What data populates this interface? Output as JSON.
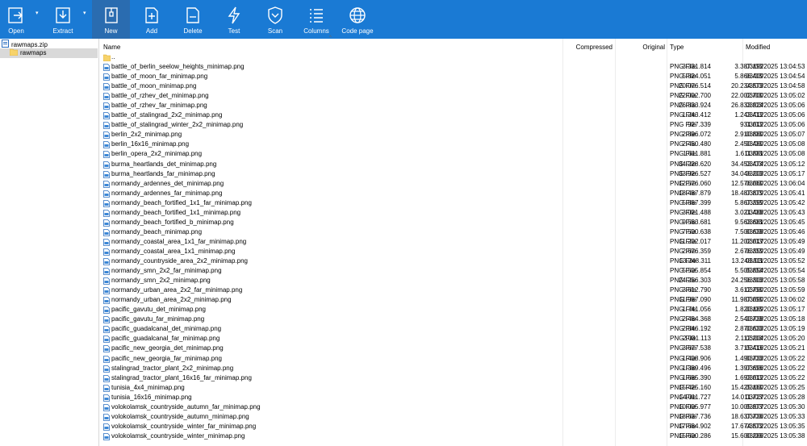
{
  "toolbar": [
    {
      "label": "Open",
      "icon": "open-icon",
      "name": "open",
      "dropdown": true
    },
    {
      "label": "Extract",
      "icon": "extract-icon",
      "name": "extract",
      "dropdown": true
    },
    {
      "label": "New",
      "icon": "new-archive-icon",
      "name": "new",
      "active": true
    },
    {
      "label": "Add",
      "icon": "add-icon",
      "name": "add"
    },
    {
      "label": "Delete",
      "icon": "delete-icon",
      "name": "delete"
    },
    {
      "label": "Test",
      "icon": "test-icon",
      "name": "test"
    },
    {
      "label": "Scan",
      "icon": "scan-icon",
      "name": "scan"
    },
    {
      "label": "Columns",
      "icon": "columns-icon",
      "name": "columns"
    },
    {
      "label": "Code page",
      "icon": "code-page-icon",
      "name": "code-page"
    }
  ],
  "tree": {
    "archive": "rawmaps.zip",
    "folder": "rawmaps"
  },
  "columns": {
    "name": "Name",
    "compressed": "Compressed",
    "original": "Original",
    "type": "Type",
    "modified": "Modified"
  },
  "parent_row": "..",
  "files": [
    {
      "name": "battle_of_berlin_seelow_heights_minimap.png",
      "compressed": "3.331.814",
      "original": "3.387.192",
      "type": "PNG File",
      "modified": "03/03/2025 13:04:53"
    },
    {
      "name": "battle_of_moon_far_minimap.png",
      "compressed": "5.824.051",
      "original": "5.866.409",
      "type": "PNG File",
      "modified": "03/03/2025 13:04:54"
    },
    {
      "name": "battle_of_moon_minimap.png",
      "compressed": "20.076.514",
      "original": "20.234.573",
      "type": "PNG File",
      "modified": "03/03/2025 13:04:58"
    },
    {
      "name": "battle_of_rzhev_det_minimap.png",
      "compressed": "22.002.700",
      "original": "22.002.700",
      "type": "PNG File",
      "modified": "03/03/2025 13:05:02"
    },
    {
      "name": "battle_of_rzhev_far_minimap.png",
      "compressed": "26.833.924",
      "original": "26.833.924",
      "type": "PNG File",
      "modified": "03/03/2025 13:05:06"
    },
    {
      "name": "battle_of_stalingrad_2x2_minimap.png",
      "compressed": "1.243.412",
      "original": "1.243.412",
      "type": "PNG File",
      "modified": "03/03/2025 13:05:06"
    },
    {
      "name": "battle_of_stalingrad_winter_2x2_minimap.png",
      "compressed": "927.339",
      "original": "931.012",
      "type": "PNG File",
      "modified": "03/03/2025 13:05:06"
    },
    {
      "name": "berlin_2x2_minimap.png",
      "compressed": "2.896.072",
      "original": "2.910.880",
      "type": "PNG File",
      "modified": "03/03/2025 13:05:07"
    },
    {
      "name": "berlin_16x16_minimap.png",
      "compressed": "2.450.480",
      "original": "2.450.480",
      "type": "PNG File",
      "modified": "03/03/2025 13:05:08"
    },
    {
      "name": "berlin_opera_2x2_minimap.png",
      "compressed": "1.611.881",
      "original": "1.611.881",
      "type": "PNG File",
      "modified": "03/03/2025 13:05:08"
    },
    {
      "name": "burma_heartlands_det_minimap.png",
      "compressed": "34.228.620",
      "original": "34.453.474",
      "type": "PNG File",
      "modified": "03/03/2025 13:05:12"
    },
    {
      "name": "burma_heartlands_far_minimap.png",
      "compressed": "33.926.527",
      "original": "34.046.203",
      "type": "PNG File",
      "modified": "03/03/2025 13:05:17"
    },
    {
      "name": "normandy_ardennes_det_minimap.png",
      "compressed": "12.576.060",
      "original": "12.576.060",
      "type": "PNG File",
      "modified": "03/03/2025 13:06:04"
    },
    {
      "name": "normandy_ardennes_far_minimap.png",
      "compressed": "18.487.879",
      "original": "18.487.879",
      "type": "PNG File",
      "modified": "03/03/2025 13:05:41"
    },
    {
      "name": "normandy_beach_fortified_1x1_far_minimap.png",
      "compressed": "5.867.399",
      "original": "5.867.399",
      "type": "PNG File",
      "modified": "03/03/2025 13:05:42"
    },
    {
      "name": "normandy_beach_fortified_1x1_minimap.png",
      "compressed": "3.021.488",
      "original": "3.021.488",
      "type": "PNG File",
      "modified": "03/03/2025 13:05:43"
    },
    {
      "name": "normandy_beach_fortified_b_minimap.png",
      "compressed": "9.563.681",
      "original": "9.563.681",
      "type": "PNG File",
      "modified": "03/03/2025 13:05:45"
    },
    {
      "name": "normandy_beach_minimap.png",
      "compressed": "7.500.638",
      "original": "7.500.638",
      "type": "PNG File",
      "modified": "03/03/2025 13:05:46"
    },
    {
      "name": "normandy_coastal_area_1x1_far_minimap.png",
      "compressed": "11.202.017",
      "original": "11.202.017",
      "type": "PNG File",
      "modified": "03/03/2025 13:05:49"
    },
    {
      "name": "normandy_coastal_area_1x1_minimap.png",
      "compressed": "2.676.359",
      "original": "2.676.359",
      "type": "PNG File",
      "modified": "03/03/2025 13:05:49"
    },
    {
      "name": "normandy_countryside_area_2x2_minimap.png",
      "compressed": "13.248.311",
      "original": "13.248.311",
      "type": "PNG File",
      "modified": "03/03/2025 13:05:52"
    },
    {
      "name": "normandy_smn_2x2_far_minimap.png",
      "compressed": "5.505.854",
      "original": "5.505.854",
      "type": "PNG File",
      "modified": "03/03/2025 13:05:54"
    },
    {
      "name": "normandy_smn_2x2_minimap.png",
      "compressed": "24.256.303",
      "original": "24.256.303",
      "type": "PNG File",
      "modified": "03/03/2025 13:05:58"
    },
    {
      "name": "normandy_urban_area_2x2_far_minimap.png",
      "compressed": "3.612.790",
      "original": "3.612.790",
      "type": "PNG File",
      "modified": "03/03/2025 13:05:59"
    },
    {
      "name": "normandy_urban_area_2x2_minimap.png",
      "compressed": "11.987.090",
      "original": "11.987.090",
      "type": "PNG File",
      "modified": "03/03/2025 13:06:02"
    },
    {
      "name": "pacific_gavutu_det_minimap.png",
      "compressed": "1.741.056",
      "original": "1.820.189",
      "type": "PNG File",
      "modified": "03/03/2025 13:05:17"
    },
    {
      "name": "pacific_gavutu_far_minimap.png",
      "compressed": "2.464.368",
      "original": "2.540.738",
      "type": "PNG File",
      "modified": "03/03/2025 13:05:18"
    },
    {
      "name": "pacific_guadalcanal_det_minimap.png",
      "compressed": "2.846.192",
      "original": "2.870.633",
      "type": "PNG File",
      "modified": "03/03/2025 13:05:19"
    },
    {
      "name": "pacific_guadalcanal_far_minimap.png",
      "compressed": "2.031.113",
      "original": "2.112.204",
      "type": "PNG File",
      "modified": "03/03/2025 13:05:20"
    },
    {
      "name": "pacific_new_georgia_det_minimap.png",
      "compressed": "3.677.538",
      "original": "3.715.416",
      "type": "PNG File",
      "modified": "03/03/2025 13:05:21"
    },
    {
      "name": "pacific_new_georgia_far_minimap.png",
      "compressed": "1.408.906",
      "original": "1.490.733",
      "type": "PNG File",
      "modified": "03/03/2025 13:05:22"
    },
    {
      "name": "stalingrad_tractor_plant_2x2_minimap.png",
      "compressed": "1.389.496",
      "original": "1.397.696",
      "type": "PNG File",
      "modified": "03/03/2025 13:05:22"
    },
    {
      "name": "stalingrad_tractor_plant_16x16_far_minimap.png",
      "compressed": "1.685.390",
      "original": "1.693.012",
      "type": "PNG File",
      "modified": "03/03/2025 13:05:22"
    },
    {
      "name": "tunisia_4x4_minimap.png",
      "compressed": "15.425.160",
      "original": "15.425.160",
      "type": "PNG File",
      "modified": "03/03/2025 13:05:25"
    },
    {
      "name": "tunisia_16x16_minimap.png",
      "compressed": "14.011.727",
      "original": "14.011.727",
      "type": "PNG File",
      "modified": "03/03/2025 13:05:28"
    },
    {
      "name": "volokolamsk_countryside_autumn_far_minimap.png",
      "compressed": "10.005.977",
      "original": "10.005.977",
      "type": "PNG File",
      "modified": "03/03/2025 13:05:30"
    },
    {
      "name": "volokolamsk_countryside_autumn_minimap.png",
      "compressed": "18.637.736",
      "original": "18.637.736",
      "type": "PNG File",
      "modified": "03/03/2025 13:05:33"
    },
    {
      "name": "volokolamsk_countryside_winter_far_minimap.png",
      "compressed": "17.664.902",
      "original": "17.674.572",
      "type": "PNG File",
      "modified": "03/03/2025 13:05:35"
    },
    {
      "name": "volokolamsk_countryside_winter_minimap.png",
      "compressed": "15.600.286",
      "original": "15.600.286",
      "type": "PNG File",
      "modified": "03/03/2025 13:05:38"
    }
  ]
}
